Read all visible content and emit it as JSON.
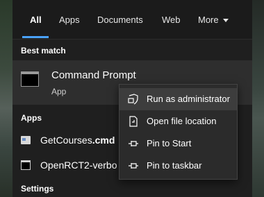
{
  "tabs": [
    {
      "label": "All",
      "active": true
    },
    {
      "label": "Apps"
    },
    {
      "label": "Documents"
    },
    {
      "label": "Web"
    },
    {
      "label": "More"
    }
  ],
  "best_match": {
    "section": "Best match",
    "title": "Command Prompt",
    "subtitle": "App"
  },
  "apps": {
    "section": "Apps",
    "items": [
      {
        "label": "GetCourses.cmd"
      },
      {
        "label": "OpenRCT2-verbo"
      }
    ]
  },
  "settings": {
    "section": "Settings"
  },
  "context_menu": {
    "items": [
      {
        "label": "Run as administrator",
        "icon": "shield-icon"
      },
      {
        "label": "Open file location",
        "icon": "file-location-icon"
      },
      {
        "label": "Pin to Start",
        "icon": "pin-icon"
      },
      {
        "label": "Pin to taskbar",
        "icon": "pin-icon"
      }
    ]
  },
  "colors": {
    "accent": "#4aa3ff",
    "panel": "#1f1f1f",
    "highlight": "#2e2e2e"
  }
}
